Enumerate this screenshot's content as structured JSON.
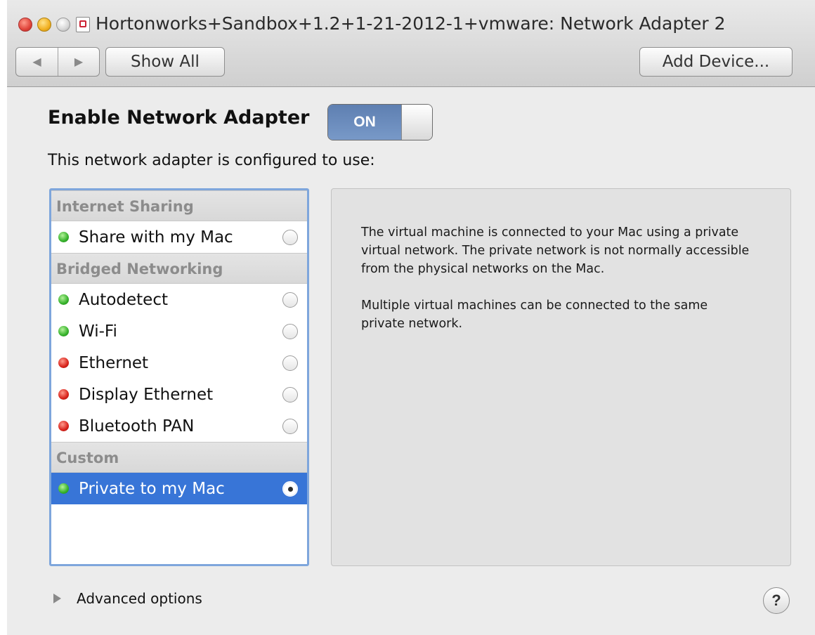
{
  "window": {
    "title": "Hortonworks+Sandbox+1.2+1-21-2012-1+vmware: Network Adapter 2"
  },
  "toolbar": {
    "back_icon": "◀",
    "forward_icon": "▶",
    "show_all_label": "Show All",
    "add_device_label": "Add Device..."
  },
  "enable": {
    "label": "Enable Network Adapter",
    "toggle_state": "ON"
  },
  "config_label": "This network adapter is configured to use:",
  "network_list": {
    "sections": [
      {
        "header": "Internet Sharing",
        "items": [
          {
            "label": "Share with my Mac",
            "status": "green",
            "selected": false
          }
        ]
      },
      {
        "header": "Bridged Networking",
        "items": [
          {
            "label": "Autodetect",
            "status": "green",
            "selected": false
          },
          {
            "label": "Wi-Fi",
            "status": "green",
            "selected": false
          },
          {
            "label": "Ethernet",
            "status": "red",
            "selected": false
          },
          {
            "label": "Display Ethernet",
            "status": "red",
            "selected": false
          },
          {
            "label": "Bluetooth PAN",
            "status": "red",
            "selected": false
          }
        ]
      },
      {
        "header": "Custom",
        "items": [
          {
            "label": "Private to my Mac",
            "status": "green",
            "selected": true
          }
        ]
      }
    ]
  },
  "description": {
    "paragraph1": "The virtual machine is connected to your Mac using a private virtual network. The private network is not normally accessible from the physical networks on the Mac.",
    "paragraph2": "Multiple virtual machines can be connected to the same private network."
  },
  "advanced_label": "Advanced options",
  "help_label": "?",
  "colors": {
    "selection": "#3875d7",
    "toggle_on": "#6b8cbf",
    "status_green": "#35b12a",
    "status_red": "#d8221a",
    "list_focus_border": "#7ea6dc"
  }
}
